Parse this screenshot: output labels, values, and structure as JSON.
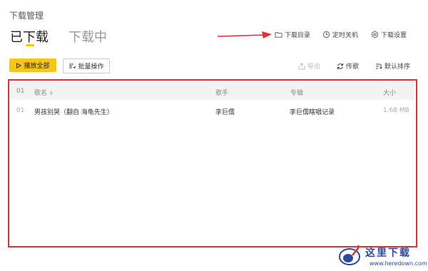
{
  "header": {
    "title": "下载管理",
    "tabs": [
      {
        "label": "已下载",
        "active": true
      },
      {
        "label": "下载中",
        "active": false
      }
    ],
    "actions": {
      "folder": "下载目录",
      "shutdown": "定时关机",
      "settings": "下载设置"
    }
  },
  "toolbar": {
    "play_all": "播放全部",
    "batch": "批量操作",
    "export": "导出",
    "transfer": "传歌",
    "sort": "默认排序"
  },
  "table": {
    "columns": {
      "index": "01",
      "name": "歌名",
      "artist": "歌手",
      "album": "专辑",
      "size": "大小"
    },
    "rows": [
      {
        "index": "01",
        "name": "男孩别哭（翻自 海龟先生）",
        "artist": "李巨儒",
        "album": "李巨儒瞎唱记录",
        "size": "1.68 MB"
      }
    ]
  },
  "watermark": {
    "brand": "这里下载",
    "url": "www.heredown.com"
  },
  "colors": {
    "accent": "#f5c518",
    "highlight_border": "#e03030",
    "arrow": "#e03030",
    "header_bg": "#f3f3f3"
  }
}
